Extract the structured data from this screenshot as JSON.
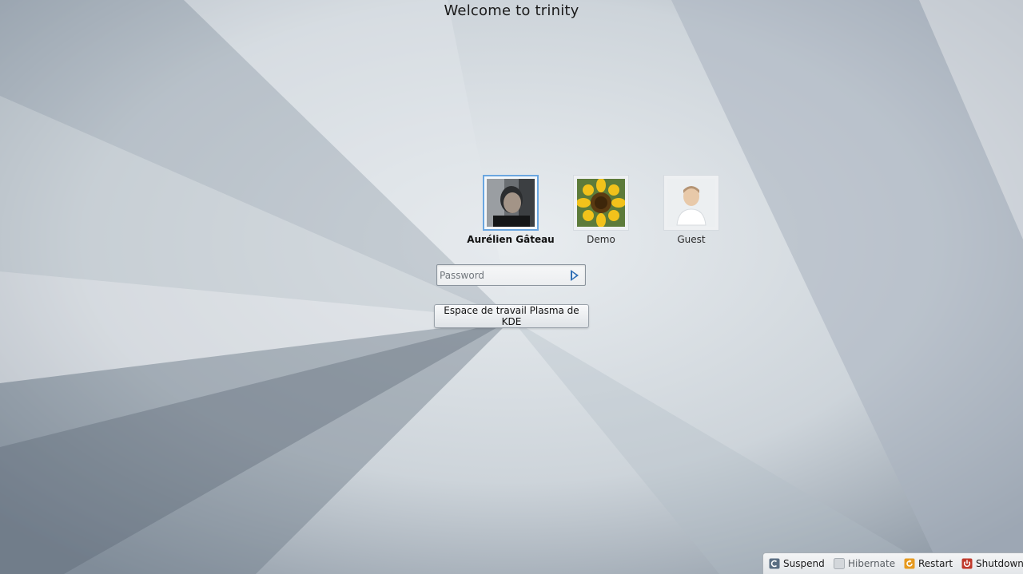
{
  "header": {
    "title": "Welcome to trinity"
  },
  "users": [
    {
      "name": "Aurélien Gâteau",
      "icon": "user-photo-icon",
      "selected": true
    },
    {
      "name": "Demo",
      "icon": "sunflower-icon",
      "selected": false
    },
    {
      "name": "Guest",
      "icon": "default-avatar-icon",
      "selected": false
    }
  ],
  "login": {
    "password_placeholder": "Password",
    "password_value": "",
    "session_label": "Espace de travail Plasma de KDE"
  },
  "power": {
    "suspend": "Suspend",
    "hibernate": "Hibernate",
    "restart": "Restart",
    "shutdown": "Shutdown"
  },
  "colors": {
    "selection_border": "#6aa6e0",
    "arrow": "#2f6fb5",
    "shutdown_icon": "#c0392b",
    "restart_icon": "#e69a1f"
  }
}
